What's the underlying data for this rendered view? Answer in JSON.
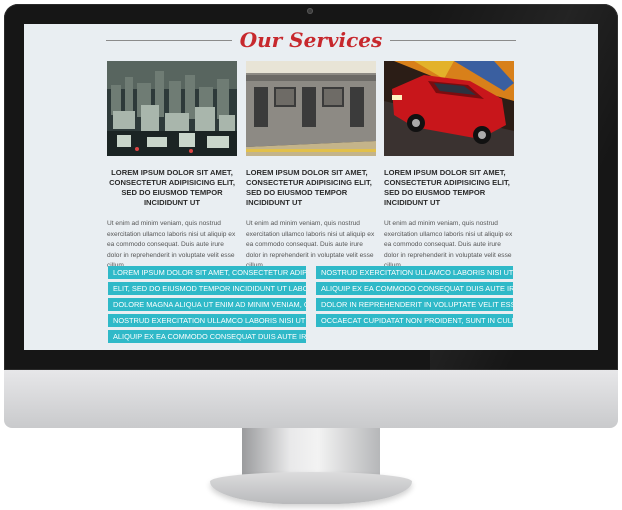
{
  "services": {
    "title": "Our Services",
    "items": [
      {
        "image": "city-miniature",
        "title": "LOREM IPSUM DOLOR SIT AMET, CONSECTETUR ADIPISICING ELIT, SED DO EIUSMOD TEMPOR INCIDIDUNT UT",
        "text": "Ut enim ad minim veniam, quis nostrud exercitation ullamco laboris nisi ut aliquip ex ea commodo consequat. Duis aute irure dolor in reprehenderit in voluptate velit esse cillum"
      },
      {
        "image": "subway-train",
        "title": "LOREM IPSUM DOLOR SIT AMET, CONSECTETUR ADIPISICING ELIT, SED DO EIUSMOD TEMPOR INCIDIDUNT UT",
        "text": "Ut enim ad minim veniam, quis nostrud exercitation ullamco laboris nisi ut aliquip ex ea commodo consequat. Duis aute irure dolor in reprehenderit in voluptate velit esse cillum"
      },
      {
        "image": "red-car",
        "title": "LOREM IPSUM DOLOR SIT AMET, CONSECTETUR ADIPISICING ELIT, SED DO EIUSMOD TEMPOR INCIDIDUNT UT",
        "text": "Ut enim ad minim veniam, quis nostrud exercitation ullamco laboris nisi ut aliquip ex ea commodo consequat. Duis aute irure dolor in reprehenderit in voluptate velit esse cillum"
      }
    ]
  },
  "tags": {
    "left": [
      "LOREM IPSUM DOLOR SIT AMET, CONSECTETUR ADIPISICING",
      "ELIT, SED DO EIUSMOD TEMPOR INCIDIDUNT UT LABORE ET",
      "DOLORE MAGNA ALIQUA UT ENIM AD MINIM VENIAM, QUIS",
      "NOSTRUD EXERCITATION ULLAMCO LABORIS NISI UT",
      "ALIQUIP EX EA COMMODO CONSEQUAT DUIS AUTE IRURE"
    ],
    "right": [
      "NOSTRUD EXERCITATION ULLAMCO LABORIS NISI UT",
      "ALIQUIP EX EA COMMODO CONSEQUAT DUIS AUTE IRURE",
      "DOLOR IN REPREHENDERIT IN VOLUPTATE VELIT ESSE SINT",
      "OCCAECAT CUPIDATAT NON PROIDENT, SUNT IN CULPA QUI"
    ]
  },
  "colors": {
    "accent_heading": "#c7282d",
    "tag_background": "#2fb9c8",
    "screen_background": "#e9eef2"
  }
}
